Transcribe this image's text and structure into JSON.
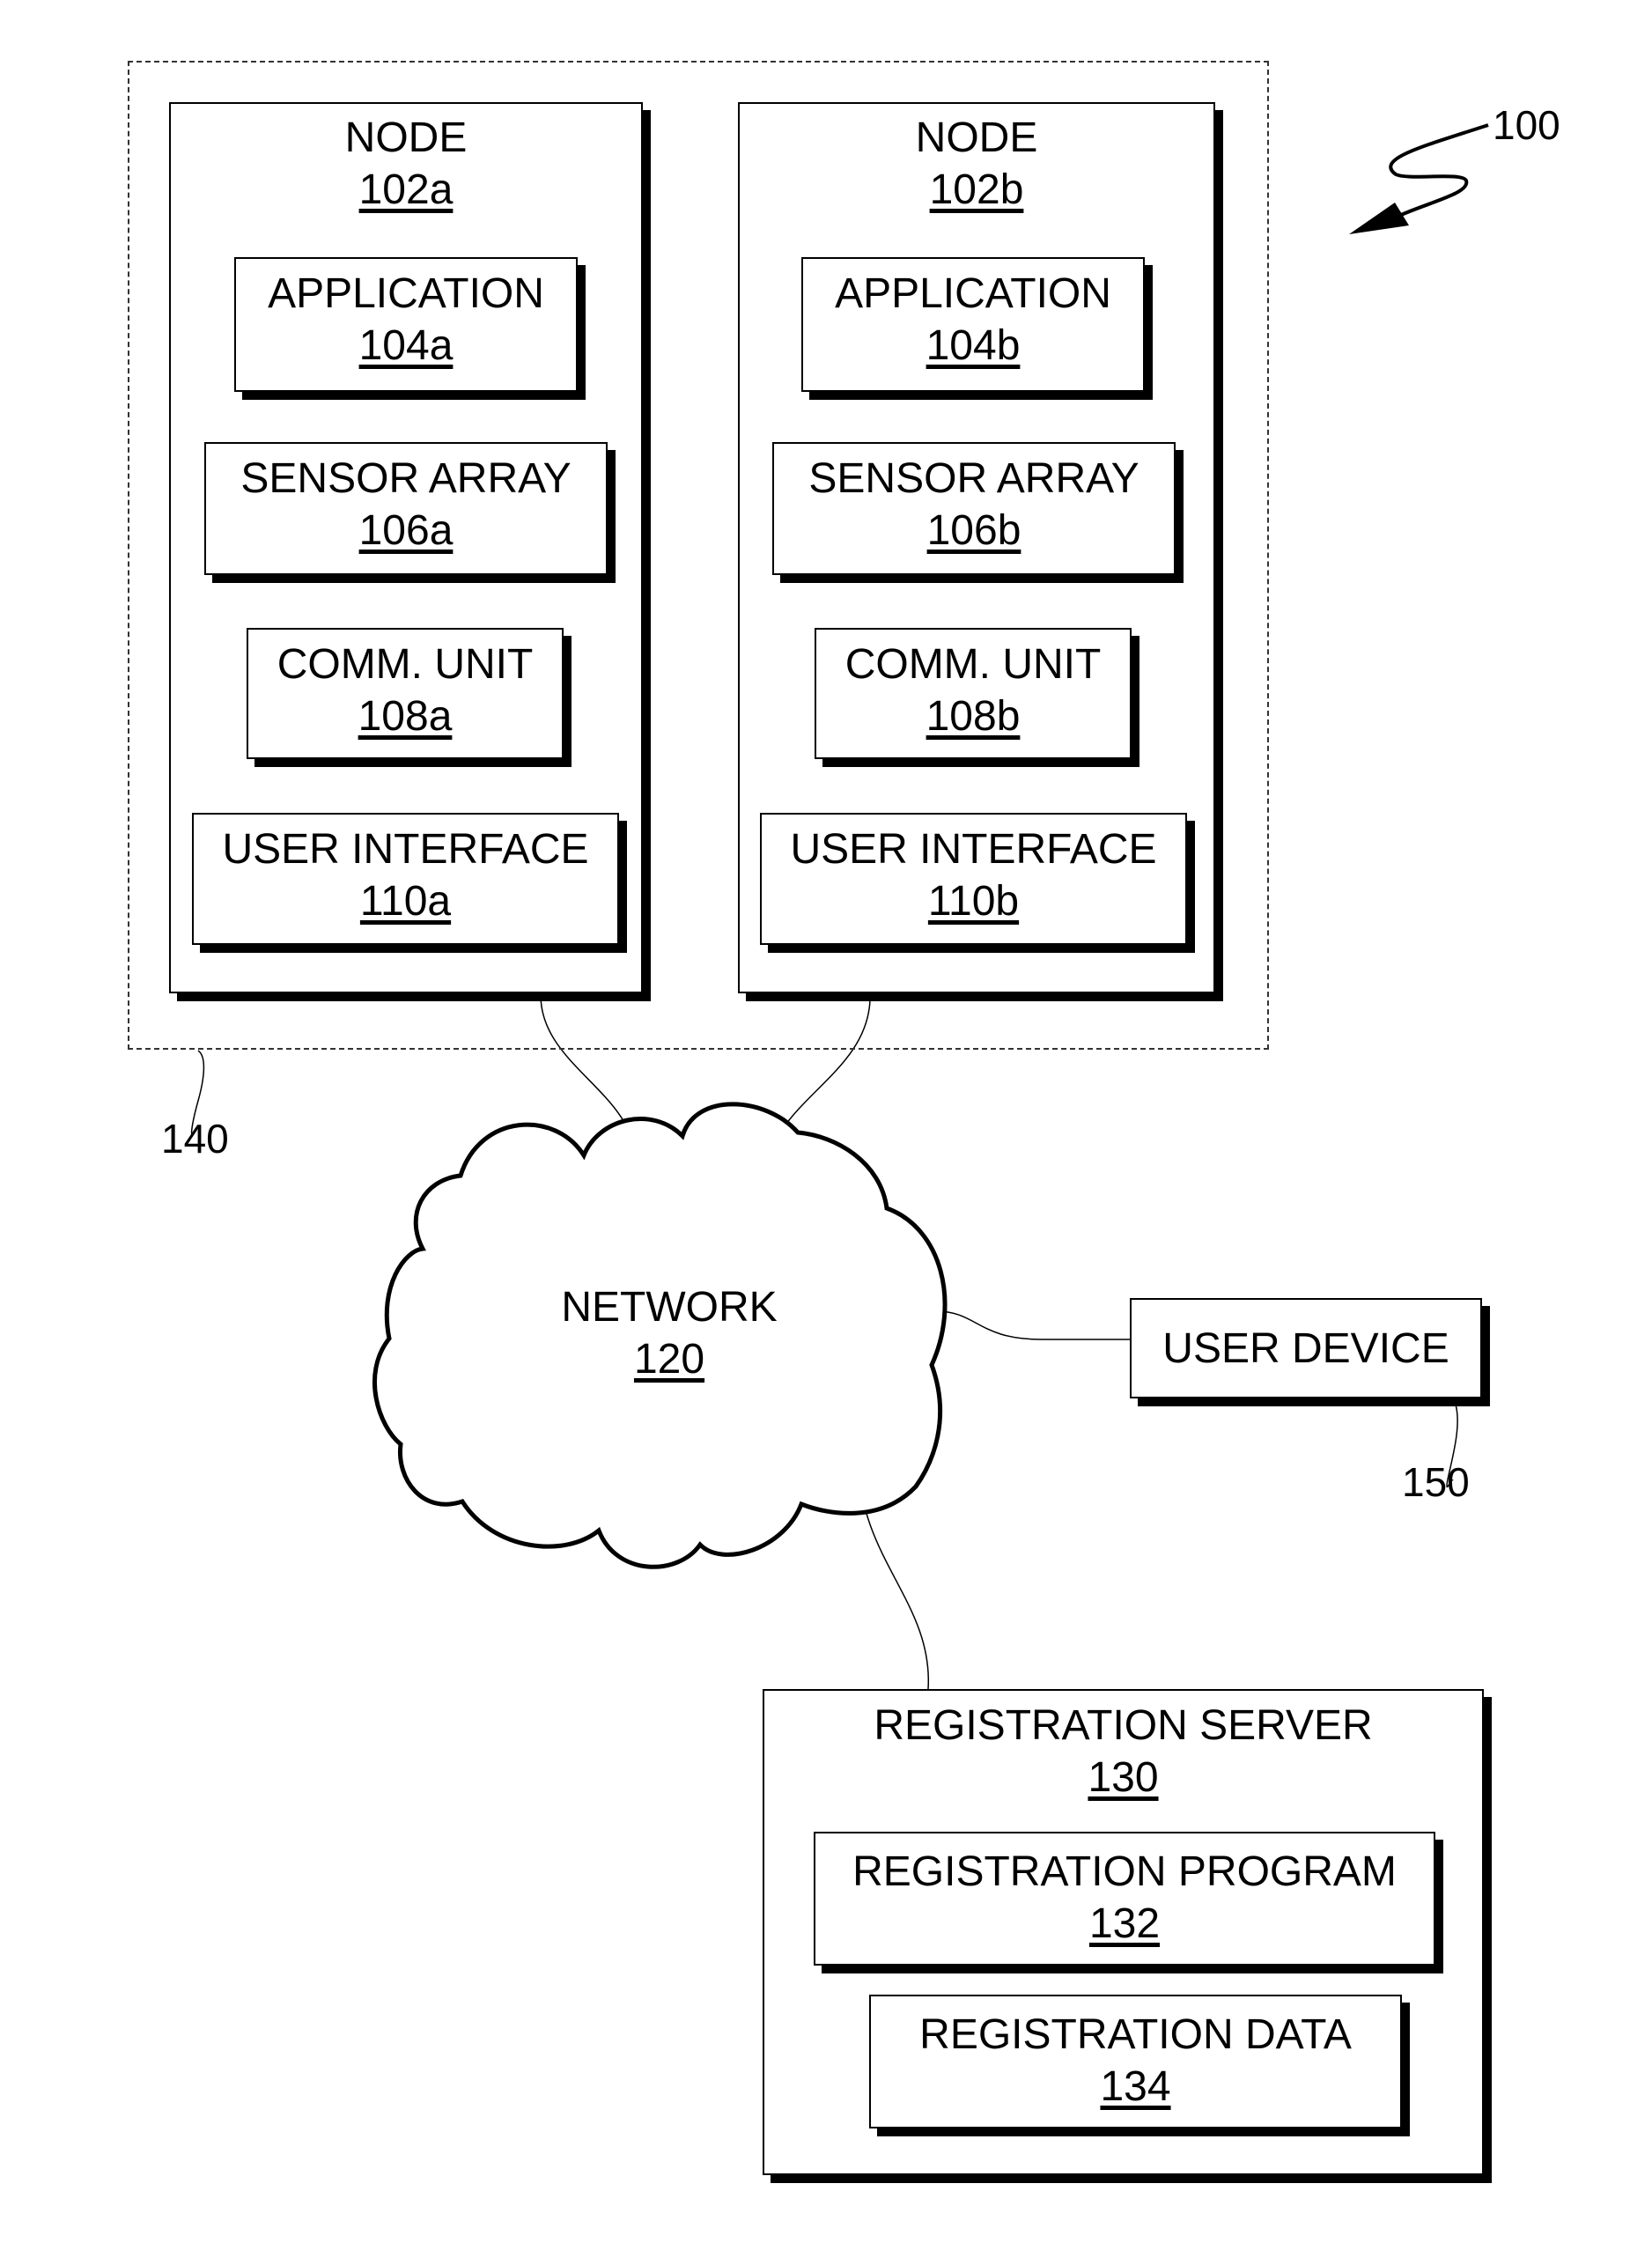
{
  "figure": {
    "ref_number": "100",
    "group_ref": "140",
    "nodes": [
      {
        "title": "NODE",
        "ref": "102a",
        "components": [
          {
            "title": "APPLICATION",
            "ref": "104a"
          },
          {
            "title": "SENSOR ARRAY",
            "ref": "106a"
          },
          {
            "title": "COMM. UNIT",
            "ref": "108a"
          },
          {
            "title": "USER INTERFACE",
            "ref": "110a"
          }
        ]
      },
      {
        "title": "NODE",
        "ref": "102b",
        "components": [
          {
            "title": "APPLICATION",
            "ref": "104b"
          },
          {
            "title": "SENSOR ARRAY",
            "ref": "106b"
          },
          {
            "title": "COMM. UNIT",
            "ref": "108b"
          },
          {
            "title": "USER INTERFACE",
            "ref": "110b"
          }
        ]
      }
    ],
    "network": {
      "title": "NETWORK",
      "ref": "120"
    },
    "user_device": {
      "title": "USER DEVICE",
      "ref": "150"
    },
    "server": {
      "title": "REGISTRATION SERVER",
      "ref": "130",
      "components": [
        {
          "title": "REGISTRATION PROGRAM",
          "ref": "132"
        },
        {
          "title": "REGISTRATION DATA",
          "ref": "134"
        }
      ]
    }
  }
}
